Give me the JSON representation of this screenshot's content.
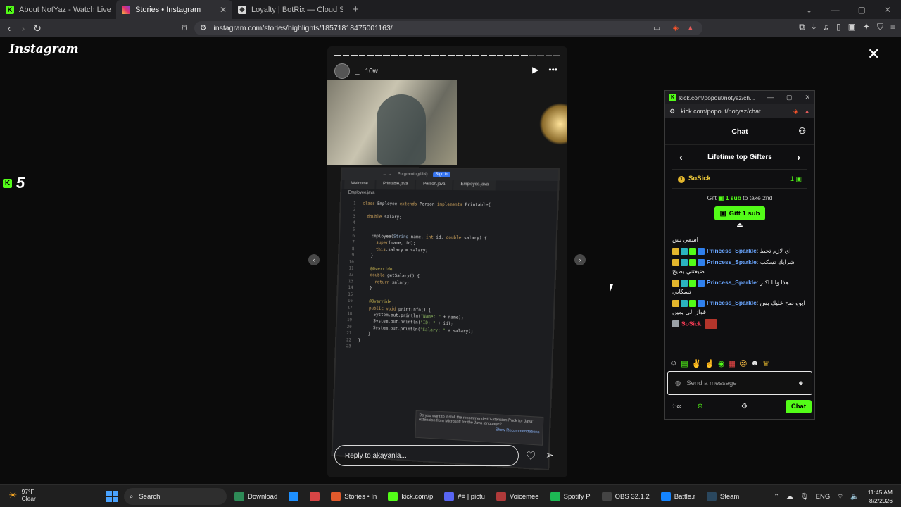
{
  "browser": {
    "tabs": [
      {
        "title": "About NotYaz - Watch Live on Kick",
        "active": false
      },
      {
        "title": "Stories • Instagram",
        "active": true
      },
      {
        "title": "Loyalty | BotRix — Cloud Streaming",
        "active": false
      }
    ],
    "new_tab": "+",
    "url": "instagram.com/stories/highlights/18571818475001163/"
  },
  "instagram": {
    "logo": "Instagram",
    "close": "✕",
    "story": {
      "username": "_",
      "age": "10w",
      "reply_placeholder": "Reply to akayanla...",
      "progress_filled": 24,
      "progress_total": 28
    }
  },
  "kick_overlay": {
    "count": "5"
  },
  "ide": {
    "project": "Porgraming(UN)",
    "sign_in": "Sign in",
    "tabs": [
      "Welcome",
      "Printable.java",
      "Person.java",
      "Employee.java"
    ],
    "file": "Employee.java",
    "notification": "Do you want to install the recommended 'Extension Pack for Java' extension from Microsoft for the Java language?",
    "notification_action": "Show Recommendations"
  },
  "kick_popout": {
    "window_title": "kick.com/popout/notyaz/ch...",
    "url": "kick.com/popout/notyaz/chat",
    "chat_title": "Chat",
    "gifters_title": "Lifetime top Gifters",
    "top_gifter": {
      "rank": "1",
      "name": "SoSick",
      "count": "1"
    },
    "gift_prompt_pre": "Gift",
    "gift_prompt_amount": "1 sub",
    "gift_prompt_post": "to take 2nd",
    "gift_button": "Gift 1 sub",
    "messages": [
      {
        "user": "",
        "text": "اسمي بس"
      },
      {
        "user": "Princess_Sparkle",
        "text": "اي لازم تحط"
      },
      {
        "user": "Princess_Sparkle",
        "text": "شرايك تسكب ضيعتني بطيخ"
      },
      {
        "user": "Princess_Sparkle",
        "text": "هذا وانا اكبر تسكابي"
      },
      {
        "user": "Princess_Sparkle",
        "text": "ايوه صح عليك بس قواز الي يمين"
      },
      {
        "user": "SoSick",
        "text": ""
      }
    ],
    "send_placeholder": "Send a message",
    "chat_button": "Chat",
    "colors": {
      "kick_green": "#53fc18",
      "gifter_gold": "#e7c53a",
      "username_blue": "#6aa6ff",
      "username_red": "#ff3d57"
    }
  },
  "taskbar": {
    "weather_temp": "97°F",
    "weather_desc": "Clear",
    "search_label": "Search",
    "apps": [
      {
        "label": "Download",
        "color": "#2e8b57"
      },
      {
        "label": "",
        "color": "#1e90ff"
      },
      {
        "label": "",
        "color": "#d64545"
      },
      {
        "label": "Stories • In",
        "color": "#e05a2c"
      },
      {
        "label": "kick.com/p",
        "color": "#53fc18"
      },
      {
        "label": "#≡ | pictu",
        "color": "#5865f2"
      },
      {
        "label": "Voicemee",
        "color": "#b03a3a"
      },
      {
        "label": "Spotify P",
        "color": "#1db954"
      },
      {
        "label": "OBS 32.1.2",
        "color": "#444444"
      },
      {
        "label": "Battle.r",
        "color": "#1484ff"
      },
      {
        "label": "Steam",
        "color": "#2a475e"
      }
    ],
    "lang": "ENG",
    "time": "11:45 AM",
    "date": "8/2/2026"
  }
}
